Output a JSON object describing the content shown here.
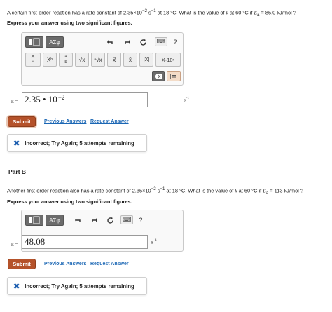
{
  "partA": {
    "question": {
      "p1": "A certain first-order reaction has a rate constant of 2.35×10",
      "p1_exp": "−2",
      "p2": " s",
      "p2_exp": "−1",
      "p3": " at 18 °C. What is the value of ",
      "var_k": "k",
      "p4": " at 60 °C if ",
      "var_E": "E",
      "var_E_sub": "a",
      "p5": " = 85.0 kJ/mol ?"
    },
    "instruction": "Express your answer using two significant figures.",
    "toolbar": {
      "templates": "ΑΣφ",
      "keyboard": "⌨",
      "help": "?",
      "row2_first": "X",
      "subscript": "X",
      "sub_sub": "b",
      "frac_num": "a",
      "frac_den": "b",
      "sqrt": "√x",
      "nroot": "ⁿ√x",
      "vec": "x⃗",
      "hat": "x̂",
      "abs": "|X|",
      "sci": "X·10ⁿ"
    },
    "label": "k =",
    "input_value": "2.35 • 10",
    "input_exp": "−2",
    "units": "s",
    "units_exp": "−1",
    "submit": "Submit",
    "previous_answers": "Previous Answers",
    "request_answer": "Request Answer",
    "feedback": "Incorrect; Try Again; 5 attempts remaining"
  },
  "partB": {
    "title": "Part B",
    "question": {
      "p1": "Another first-order reaction also has a rate constant of 2.35×10",
      "p1_exp": "−2",
      "p2": " s",
      "p2_exp": "−1",
      "p3": " at 18 °C. What is the value of ",
      "var_k": "k",
      "p4": " at 60 °C if ",
      "var_E": "E",
      "var_E_sub": "a",
      "p5": " = 113 kJ/mol ?"
    },
    "instruction": "Express your answer using two significant figures.",
    "toolbar": {
      "templates": "ΑΣφ",
      "keyboard": "⌨",
      "help": "?"
    },
    "label": "k =",
    "input_value": "48.08",
    "units": "s",
    "units_exp": "−1",
    "submit": "Submit",
    "previous_answers": "Previous Answers",
    "request_answer": "Request Answer",
    "feedback": "Incorrect; Try Again; 5 attempts remaining"
  }
}
